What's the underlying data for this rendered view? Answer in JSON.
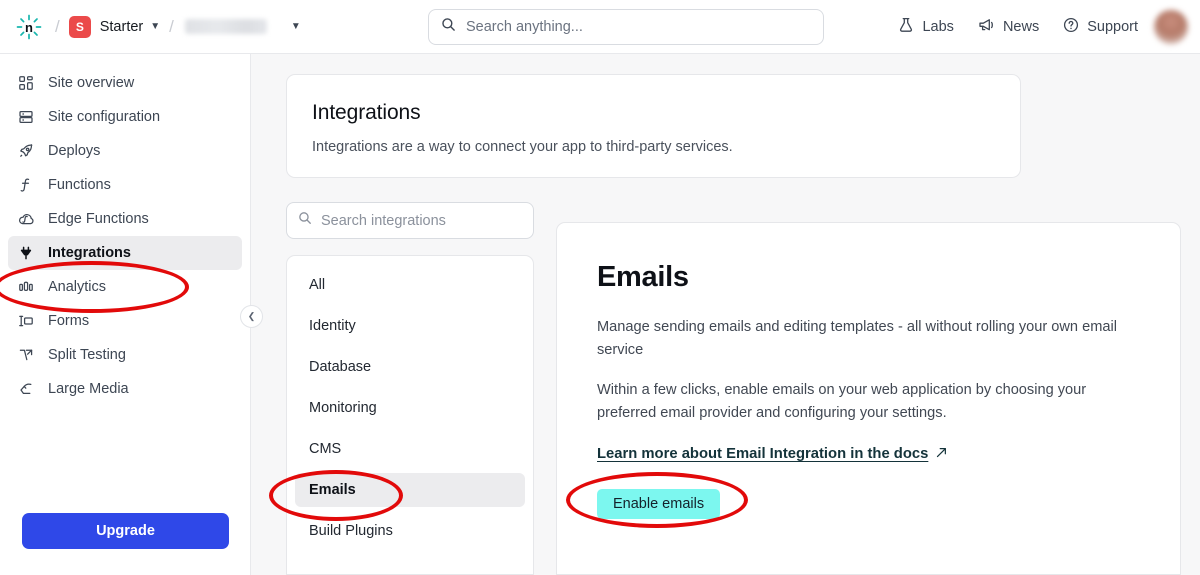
{
  "header": {
    "logo_icon": "netlify-logo-icon",
    "breadcrumb_separator": "/",
    "plan_badge": "S",
    "plan_name": "Starter",
    "site_name_redacted": "",
    "search": {
      "placeholder": "Search anything...",
      "icon": "search-icon"
    },
    "nav": [
      {
        "label": "Labs",
        "icon": "flask-icon"
      },
      {
        "label": "News",
        "icon": "megaphone-icon"
      },
      {
        "label": "Support",
        "icon": "question-circle-icon"
      }
    ],
    "avatar": "user-avatar"
  },
  "sidebar": {
    "items": [
      {
        "label": "Site overview",
        "icon": "grid-icon",
        "active": false
      },
      {
        "label": "Site configuration",
        "icon": "server-icon",
        "active": false
      },
      {
        "label": "Deploys",
        "icon": "rocket-icon",
        "active": false
      },
      {
        "label": "Functions",
        "icon": "function-icon",
        "active": false
      },
      {
        "label": "Edge Functions",
        "icon": "edge-function-icon",
        "active": false
      },
      {
        "label": "Integrations",
        "icon": "plug-icon",
        "active": true
      },
      {
        "label": "Analytics",
        "icon": "bar-chart-icon",
        "active": false
      },
      {
        "label": "Forms",
        "icon": "form-icon",
        "active": false
      },
      {
        "label": "Split Testing",
        "icon": "split-testing-icon",
        "active": false
      },
      {
        "label": "Large Media",
        "icon": "large-media-icon",
        "active": false
      }
    ],
    "upgrade_label": "Upgrade",
    "collapse_icon": "chevron-left-icon"
  },
  "main": {
    "hero": {
      "title": "Integrations",
      "description": "Integrations are a way to connect your app to third-party services."
    },
    "category_search": {
      "placeholder": "Search integrations",
      "icon": "search-icon"
    },
    "categories": [
      {
        "label": "All",
        "active": false
      },
      {
        "label": "Identity",
        "active": false
      },
      {
        "label": "Database",
        "active": false
      },
      {
        "label": "Monitoring",
        "active": false
      },
      {
        "label": "CMS",
        "active": false
      },
      {
        "label": "Emails",
        "active": true
      },
      {
        "label": "Build Plugins",
        "active": false
      }
    ],
    "detail": {
      "title": "Emails",
      "paragraph_1": "Manage sending emails and editing templates - all without rolling your own email service",
      "paragraph_2": "Within a few clicks, enable emails on your web application by choosing your preferred email provider and configuring your settings.",
      "doc_link": "Learn more about Email Integration in the docs",
      "doc_link_icon": "external-link-icon",
      "enable_button": "Enable emails"
    }
  },
  "annotations": {
    "color": "#e20a0a",
    "shapes": [
      {
        "name": "highlight-integrations-nav"
      },
      {
        "name": "highlight-emails-category"
      },
      {
        "name": "highlight-enable-emails-button"
      }
    ]
  },
  "colors": {
    "accent_blue": "#2f48e8",
    "button_cyan": "#7cf7ef",
    "brand_teal": "#14b1ab",
    "plan_badge_red": "#eb4a4a",
    "annotation_red": "#e20a0a"
  }
}
